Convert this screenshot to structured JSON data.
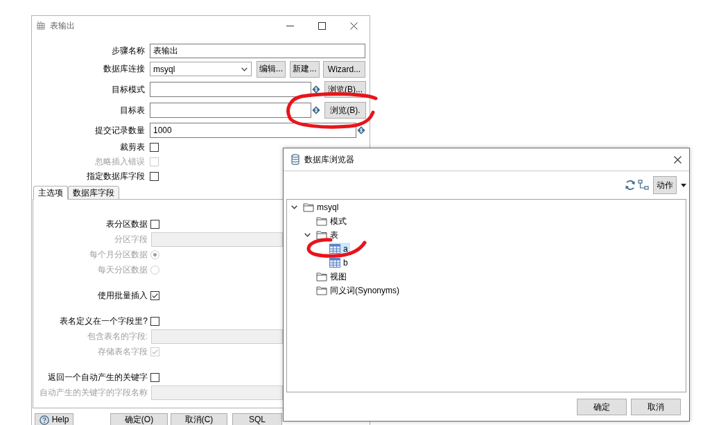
{
  "main_dialog": {
    "title": "表输出",
    "fields": [
      {
        "kind": "text",
        "label": "步骤名称",
        "value": "表输出",
        "disabled": false
      },
      {
        "kind": "select",
        "label": "数据库连接",
        "value": "msyql",
        "disabled": false,
        "buttons": [
          "编辑...",
          "新建...",
          "Wizard..."
        ]
      },
      {
        "kind": "browse",
        "label": "目标模式",
        "disabled": false,
        "button": "浏览(B)..."
      },
      {
        "kind": "browse",
        "label": "目标表",
        "disabled": false,
        "button": "浏览(B)."
      },
      {
        "kind": "variable",
        "label": "提交记录数量",
        "value": "1000",
        "disabled": false
      },
      {
        "kind": "checkbox",
        "label": "裁剪表",
        "checked": false,
        "disabled": false
      },
      {
        "kind": "checkbox",
        "label": "忽略插入错误",
        "checked": false,
        "disabled": true
      },
      {
        "kind": "checkbox",
        "label": "指定数据库字段",
        "checked": false,
        "disabled": false
      }
    ],
    "tabs": [
      {
        "label": "主选项",
        "selected": true
      },
      {
        "label": "数据库字段",
        "selected": false
      }
    ],
    "option_groups": [
      {
        "items": [
          {
            "kind": "checkbox",
            "label": "表分区数据",
            "checked": false,
            "disabled": false
          },
          {
            "kind": "text",
            "label": "分区字段",
            "disabled": true
          },
          {
            "kind": "radio",
            "label": "每个月分区数据",
            "selected": true,
            "disabled": true
          },
          {
            "kind": "radio",
            "label": "每天分区数据",
            "selected": false,
            "disabled": true
          }
        ]
      },
      {
        "items": [
          {
            "kind": "checkbox",
            "label": "使用批量插入",
            "checked": true,
            "disabled": false
          }
        ]
      },
      {
        "items": [
          {
            "kind": "checkbox",
            "label": "表名定义在一个字段里?",
            "checked": false,
            "disabled": false
          },
          {
            "kind": "text",
            "label": "包含表名的字段:",
            "disabled": true
          },
          {
            "kind": "checkbox",
            "label": "存储表名字段",
            "checked": true,
            "disabled": true
          }
        ]
      },
      {
        "items": [
          {
            "kind": "checkbox",
            "label": "返回一个自动产生的关键字",
            "checked": false,
            "disabled": false
          },
          {
            "kind": "text",
            "label": "自动产生的关键字的字段名称",
            "disabled": true
          }
        ]
      }
    ],
    "buttons": [
      {
        "kind": "help",
        "label": "Help"
      },
      {
        "kind": "plain",
        "label": "确定(O)"
      },
      {
        "kind": "plain",
        "label": "取消(C)"
      },
      {
        "kind": "plain",
        "label": "SQL"
      }
    ]
  },
  "browser_dialog": {
    "title": "数据库浏览器",
    "action_button": "动作",
    "tree": [
      {
        "kind": "folder",
        "label": "msyql",
        "expanded": true,
        "selected": false,
        "children": [
          {
            "kind": "folder",
            "label": "模式",
            "selected": false
          },
          {
            "kind": "folder",
            "label": "表",
            "expanded": true,
            "selected": false,
            "children": [
              {
                "kind": "table",
                "label": "a",
                "selected": true
              },
              {
                "kind": "table",
                "label": "b",
                "selected": false
              }
            ]
          },
          {
            "kind": "folder",
            "label": "视图",
            "selected": false
          },
          {
            "kind": "folder",
            "label": "同义词(Synonyms)",
            "selected": false
          }
        ]
      }
    ],
    "buttons": [
      "确定",
      "取消"
    ]
  }
}
